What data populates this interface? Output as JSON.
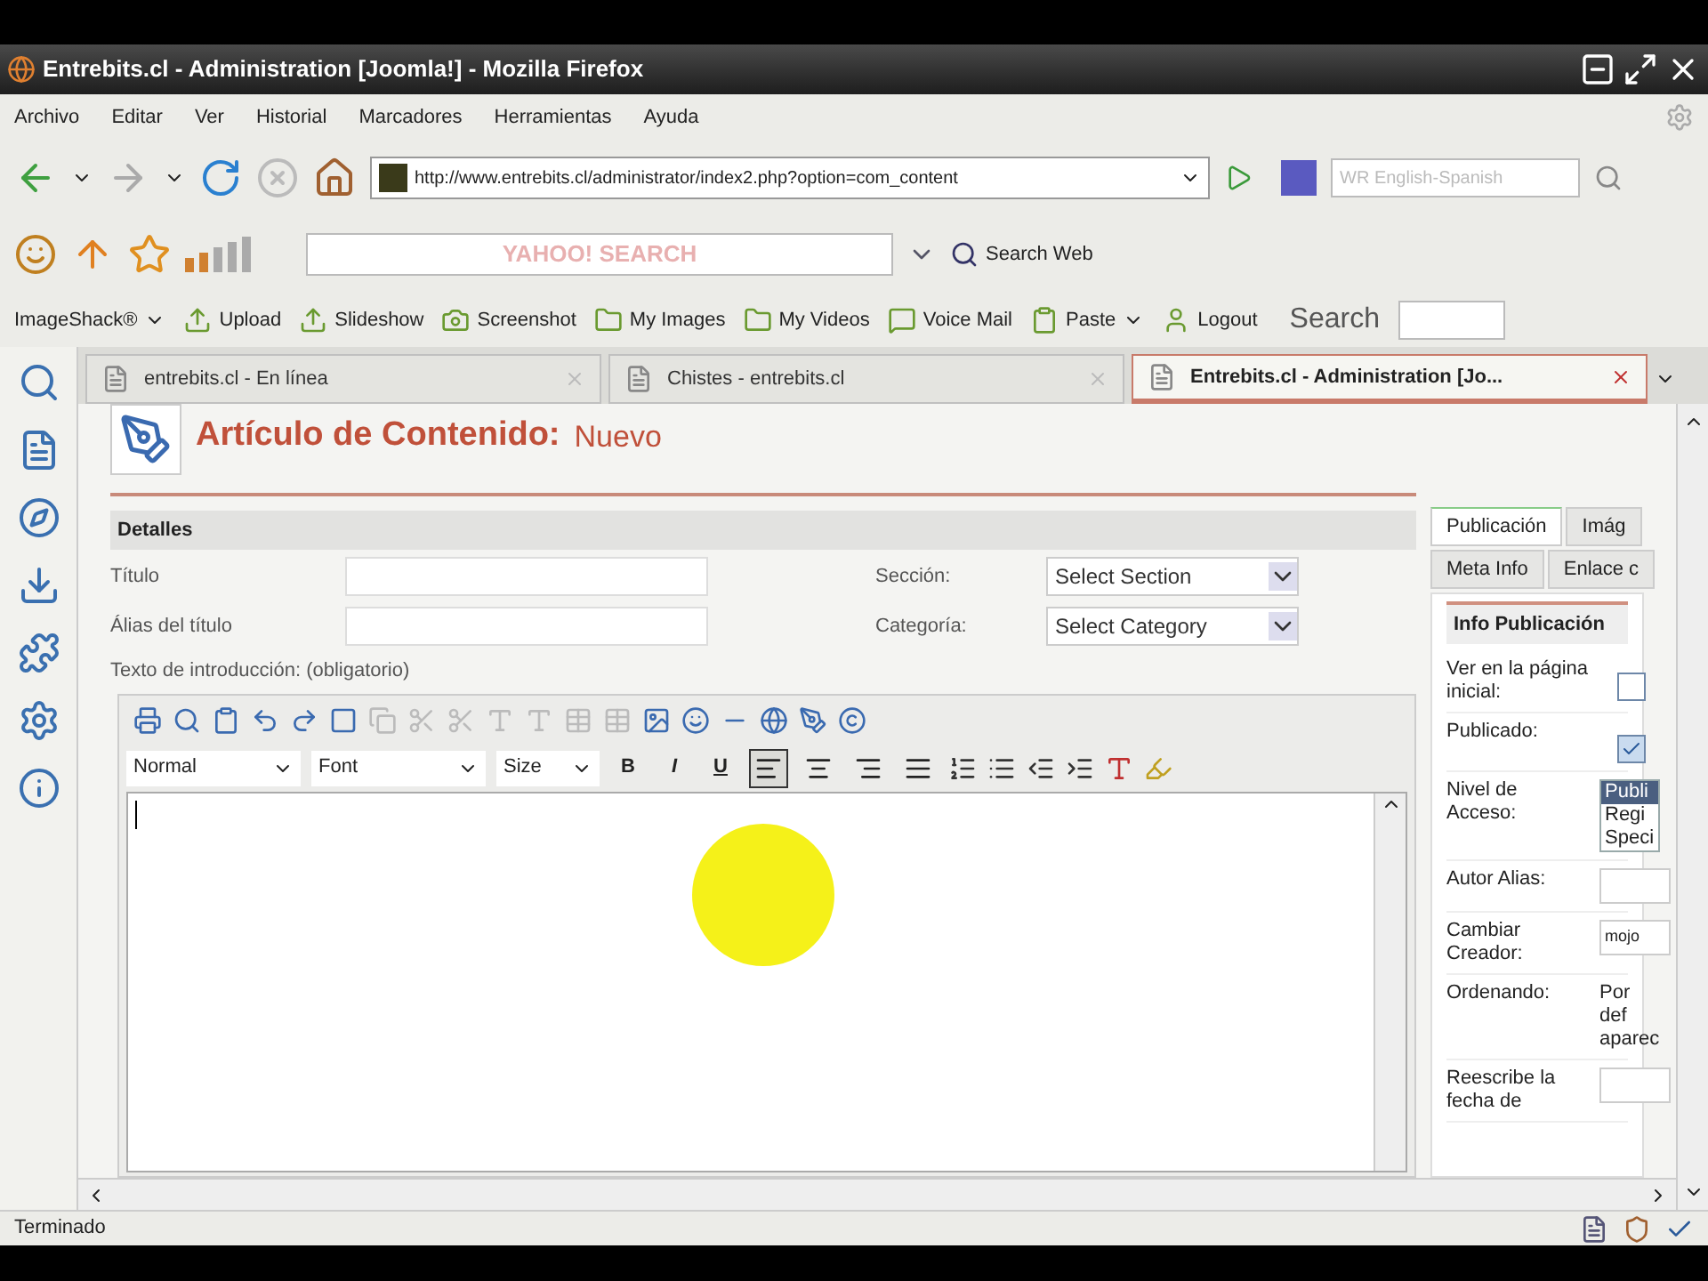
{
  "window": {
    "title": "Entrebits.cl - Administration [Joomla!] - Mozilla Firefox"
  },
  "menu": [
    "Archivo",
    "Editar",
    "Ver",
    "Historial",
    "Marcadores",
    "Herramientas",
    "Ayuda"
  ],
  "nav": {
    "url": "http://www.entrebits.cl/administrator/index2.php?option=com_content",
    "translate_placeholder": "WR English-Spanish"
  },
  "yahoo": {
    "search_placeholder": "YAHOO! SEARCH",
    "search_web": "Search Web"
  },
  "bookmarks": [
    {
      "label": "ImageShack®",
      "kind": "menu"
    },
    {
      "label": "Upload",
      "kind": "link"
    },
    {
      "label": "Slideshow",
      "kind": "link"
    },
    {
      "label": "Screenshot",
      "kind": "link"
    },
    {
      "label": "My Images",
      "kind": "link"
    },
    {
      "label": "My Videos",
      "kind": "link"
    },
    {
      "label": "Voice Mail",
      "kind": "link"
    },
    {
      "label": "Paste",
      "kind": "menu"
    },
    {
      "label": "Logout",
      "kind": "link"
    }
  ],
  "search_label": "Search",
  "tabs": [
    {
      "label": "entrebits.cl - En línea",
      "selected": false
    },
    {
      "label": "Chistes - entrebits.cl",
      "selected": false
    },
    {
      "label": "Entrebits.cl - Administration [Jo...",
      "selected": true
    }
  ],
  "page": {
    "heading": "Artículo de Contenido:",
    "subheading": "Nuevo",
    "section": "Detalles",
    "fields": [
      {
        "label": "Título"
      },
      {
        "label": "Álias del título"
      }
    ],
    "selects": [
      {
        "label": "Sección:",
        "value": "Select Section"
      },
      {
        "label": "Categoría:",
        "value": "Select Category"
      }
    ],
    "intro_label": "Texto de introducción: (obligatorio)",
    "editor": {
      "format": "Normal",
      "font": "Font",
      "size": "Size",
      "bold": "B",
      "italic": "I",
      "underline": "U",
      "alignment": [
        {
          "selected": true
        },
        {
          "selected": false
        },
        {
          "selected": false
        },
        {
          "selected": false
        }
      ]
    }
  },
  "panel": {
    "tabs": [
      [
        {
          "label": "Publicación",
          "selected": true
        },
        {
          "label": "Imág",
          "selected": false
        }
      ],
      [
        {
          "label": "Meta Info",
          "selected": false
        },
        {
          "label": "Enlace c",
          "selected": false
        }
      ]
    ],
    "heading": "Info Publicación",
    "rows": [
      {
        "kind": "checkbox",
        "label": "Ver en la página inicial:",
        "checked": false
      },
      {
        "kind": "checkbox",
        "label": "Publicado:",
        "checked": true
      },
      {
        "kind": "listbox",
        "label": "Nivel de Acceso:",
        "options": [
          {
            "label": "Publi",
            "selected": true
          },
          {
            "label": "Regi",
            "selected": false
          },
          {
            "label": "Speci",
            "selected": false
          }
        ]
      },
      {
        "kind": "input",
        "label": "Autor Alias:"
      },
      {
        "kind": "input",
        "label": "Cambiar Creador:",
        "value": "mojo"
      },
      {
        "kind": "text",
        "label": "Ordenando:",
        "value": "Por def aparec"
      },
      {
        "kind": "input",
        "label": "Reescribe la fecha de"
      }
    ]
  },
  "status_bar": "Terminado"
}
